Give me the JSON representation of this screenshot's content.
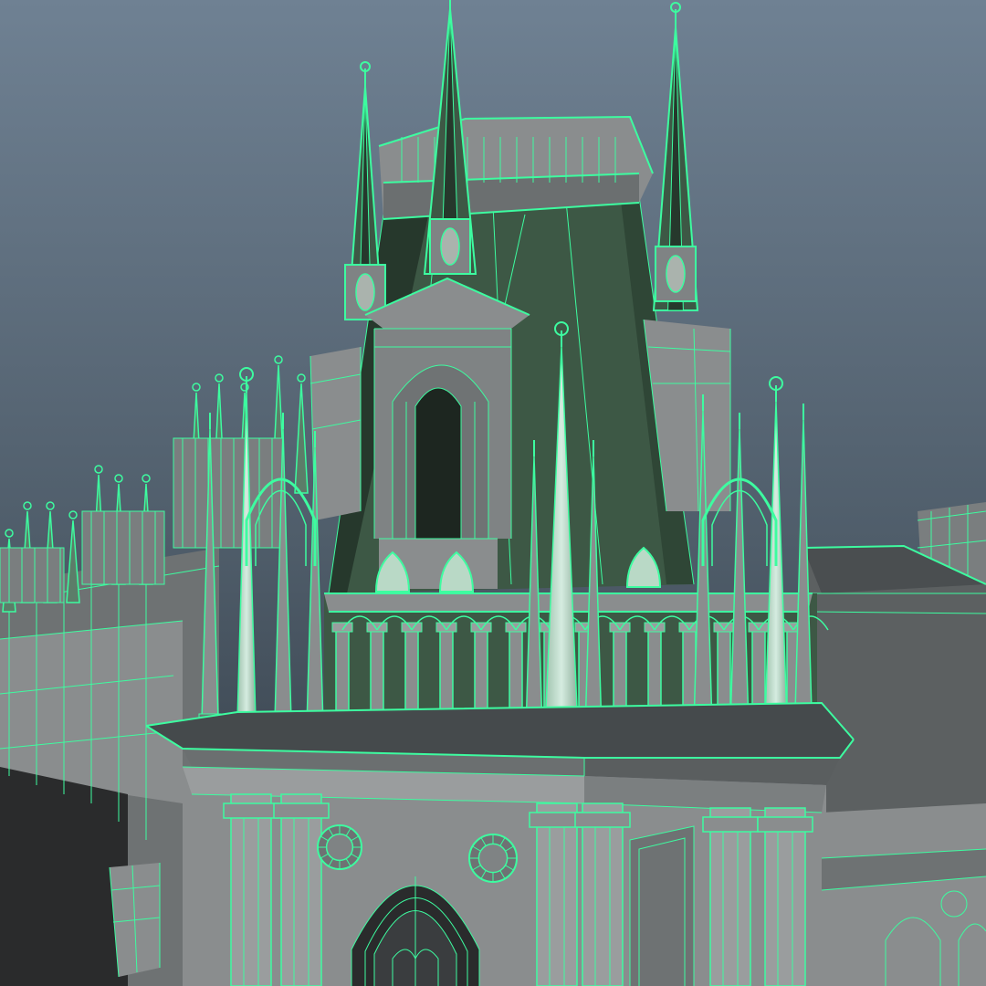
{
  "viewport": {
    "name": "3d-perspective-viewport",
    "display_mode": "wireframe-on-shaded",
    "colors": {
      "sky_top": "#6f8193",
      "sky_bottom": "#2f3740",
      "wireframe": "#3dfca0",
      "surface_grey": "#8a8d8e",
      "surface_dark": "#5a5e5f",
      "roof_green": "#3d5845",
      "roof_green_dark": "#26382c",
      "cornice_dark": "#454a4c",
      "highlight_mint": "#b9d9c6"
    }
  },
  "model": {
    "subject": "gothic-palace-model",
    "visible_parts": [
      "central-tower",
      "spires",
      "balustrade",
      "arcade-columns",
      "cornice",
      "gothic-arch-window",
      "rose-medallions",
      "side-wings"
    ]
  }
}
